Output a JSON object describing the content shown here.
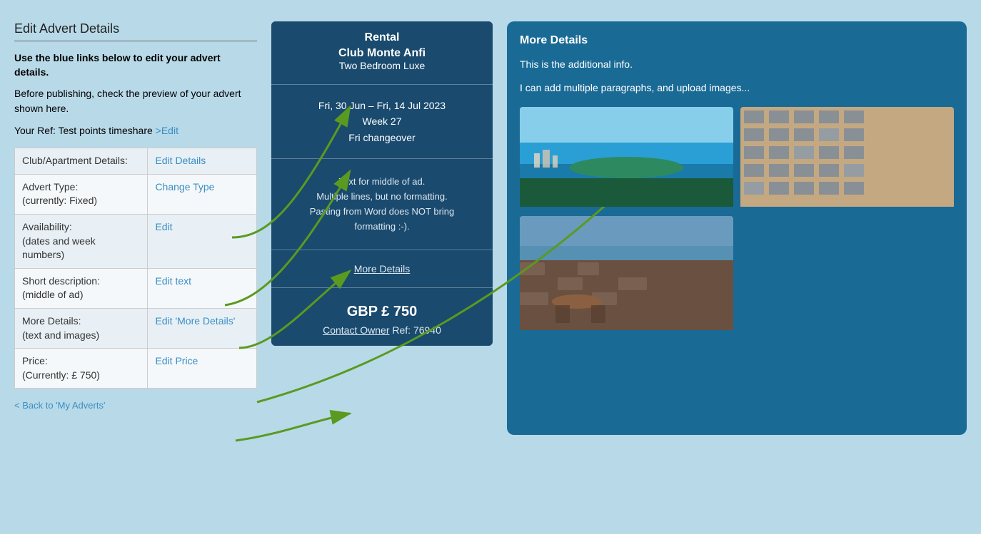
{
  "page": {
    "title": "Edit Advert Details",
    "background_color": "#b8d9e8"
  },
  "left_panel": {
    "heading": "Edit Advert Details",
    "intro_bold": "Use the blue links below to edit your advert details.",
    "intro_text": "Before publishing, check the preview of your advert shown here.",
    "ref_label": "Your Ref: Test points timeshare ",
    "ref_edit_link": ">Edit",
    "table_rows": [
      {
        "label": "Club/Apartment Details:",
        "action": "Edit Details"
      },
      {
        "label": "Advert Type:\n(currently: Fixed)",
        "action": "Change Type"
      },
      {
        "label": "Availability:\n(dates and week numbers)",
        "action": "Edit"
      },
      {
        "label": "Short description:\n(middle of ad)",
        "action": "Edit text"
      },
      {
        "label": "More Details:\n(text and images)",
        "action": "Edit 'More Details'"
      },
      {
        "label": "Price:\n(Currently: £ 750)",
        "action": "Edit Price"
      }
    ],
    "back_link": "< Back to 'My Adverts'"
  },
  "center_card": {
    "type_label": "Rental",
    "resort_name": "Club Monte Anfi",
    "unit_type": "Two Bedroom Luxe",
    "dates": "Fri, 30 Jun – Fri, 14 Jul 2023",
    "week": "Week 27",
    "changeover": "Fri changeover",
    "middle_text": "Text for middle of ad.\nMultiple lines, but no formatting.\nPasting from Word does NOT bring\nformatting :-).",
    "more_details_link": "More Details",
    "price": "GBP £ 750",
    "contact_label": "Contact Owner",
    "ref_label": "Ref: 76940"
  },
  "right_panel": {
    "heading": "More Details",
    "paragraph1": "This is the additional info.",
    "paragraph2": "I can add multiple paragraphs, and upload images..."
  },
  "arrows": {
    "description": "Green arrows connecting left panel links to card sections"
  }
}
